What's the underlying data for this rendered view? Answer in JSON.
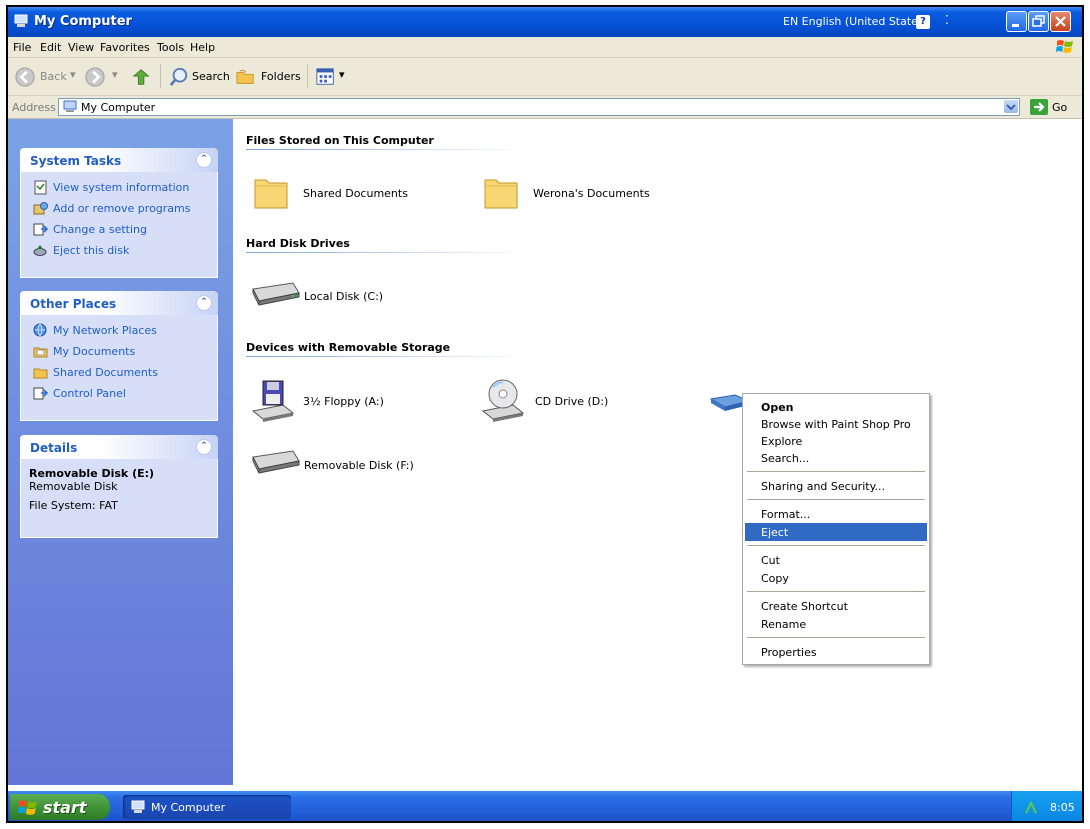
{
  "window": {
    "title": "My Computer",
    "language": "EN English (United States)",
    "help_glyph": "?"
  },
  "menu": [
    "File",
    "Edit",
    "View",
    "Favorites",
    "Tools",
    "Help"
  ],
  "toolbar": {
    "back": "Back",
    "search": "Search",
    "folders": "Folders"
  },
  "address": {
    "label": "Address",
    "value": "My Computer",
    "go": "Go"
  },
  "left_pane": {
    "system_tasks": {
      "title": "System Tasks",
      "items": [
        "View system information",
        "Add or remove programs",
        "Change a setting",
        "Eject this disk"
      ]
    },
    "other_places": {
      "title": "Other Places",
      "items": [
        "My Network Places",
        "My Documents",
        "Shared Documents",
        "Control Panel"
      ]
    },
    "details": {
      "title": "Details",
      "name": "Removable Disk (E:)",
      "type": "Removable Disk",
      "filesystem": "File System: FAT"
    }
  },
  "content": {
    "groups": [
      {
        "title": "Files Stored on This Computer",
        "items": [
          "Shared Documents",
          "Werona's Documents"
        ]
      },
      {
        "title": "Hard Disk Drives",
        "items": [
          "Local Disk (C:)"
        ]
      },
      {
        "title": "Devices with Removable Storage",
        "items": [
          "3½ Floppy (A:)",
          "CD Drive (D:)",
          "Removable Disk (F:)"
        ]
      }
    ]
  },
  "context_menu": {
    "items": [
      "Open",
      "Browse with Paint Shop Pro",
      "Explore",
      "Search...",
      "Sharing and Security...",
      "Format...",
      "Eject",
      "Cut",
      "Copy",
      "Create Shortcut",
      "Rename",
      "Properties"
    ],
    "selected": "Eject"
  },
  "taskbar": {
    "start": "start",
    "task": "My Computer",
    "clock": "8:05"
  },
  "colors": {
    "title_blue": "#0651d6",
    "link_blue": "#215dc6",
    "selection": "#316ac5",
    "start_green": "#3b8f32"
  }
}
